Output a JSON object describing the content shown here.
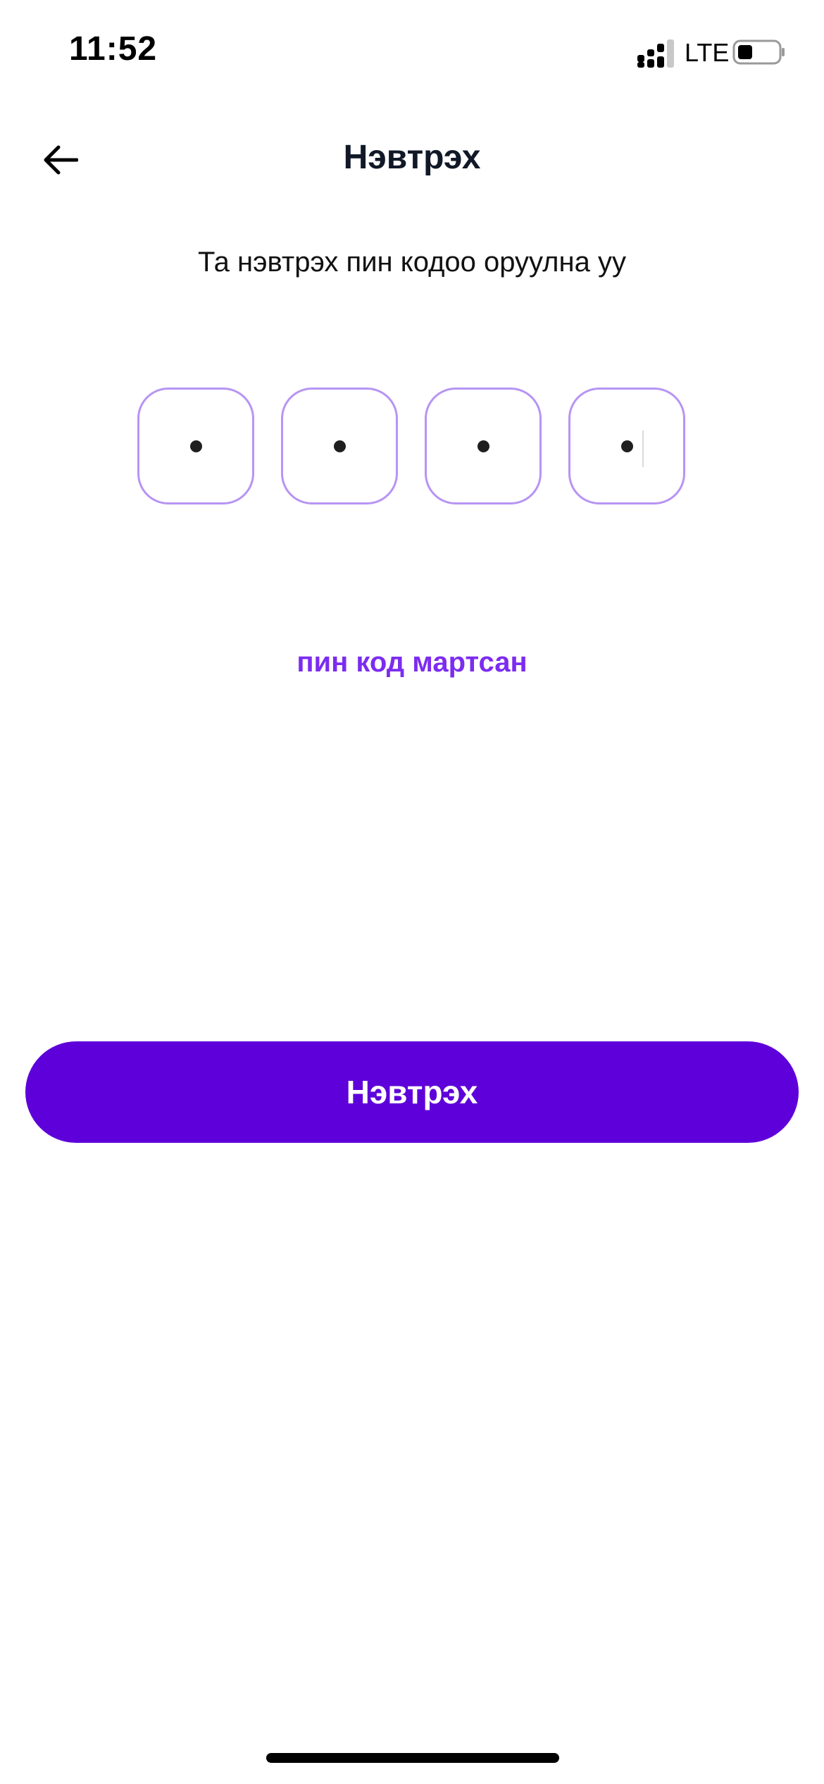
{
  "status_bar": {
    "time": "11:52",
    "network": "LTE",
    "icons": [
      "signal-icon",
      "battery-icon"
    ]
  },
  "header": {
    "title": "Нэвтрэх",
    "back_icon": "arrow-left-icon"
  },
  "instruction": "Та нэвтрэх пин кодоо оруулна уу",
  "pin": {
    "length": 4,
    "filled": 4,
    "border_color": "#b794f4"
  },
  "forgot_link": "пин код мартсан",
  "submit_button": {
    "label": "Нэвтрэх",
    "color": "#5e00d9"
  },
  "colors": {
    "accent": "#5e00d9",
    "link": "#7c2cf0"
  }
}
